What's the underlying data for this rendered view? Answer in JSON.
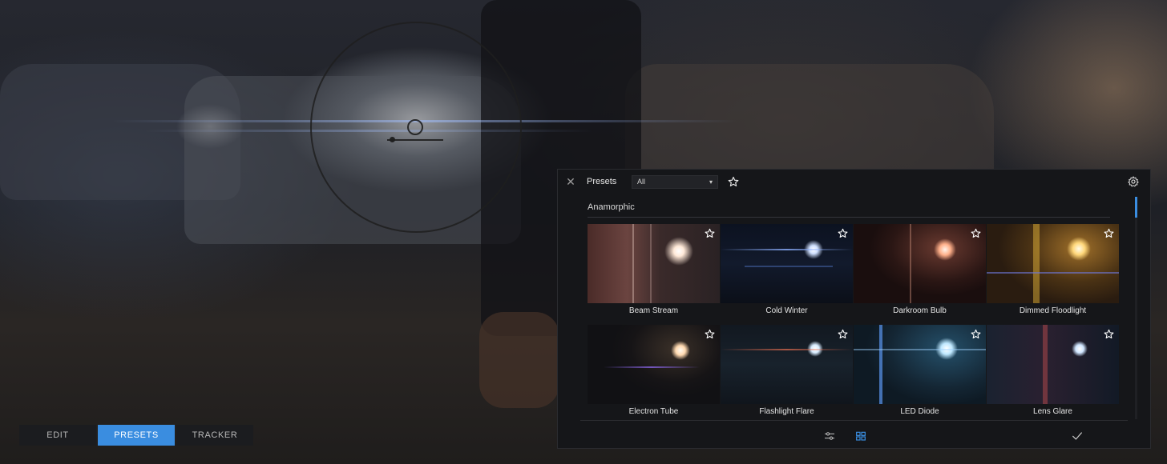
{
  "mode_tabs": [
    {
      "label": "EDIT",
      "active": false
    },
    {
      "label": "PRESETS",
      "active": true
    },
    {
      "label": "TRACKER",
      "active": false
    }
  ],
  "panel": {
    "title": "Presets",
    "filter": {
      "selected": "All"
    },
    "category": "Anamorphic",
    "presets": [
      {
        "label": "Beam Stream"
      },
      {
        "label": "Cold Winter"
      },
      {
        "label": "Darkroom Bulb"
      },
      {
        "label": "Dimmed Floodlight"
      },
      {
        "label": "Electron Tube"
      },
      {
        "label": "Flashlight Flare"
      },
      {
        "label": "LED Diode"
      },
      {
        "label": "Lens Glare"
      }
    ]
  },
  "colors": {
    "accent": "#3a8de0",
    "panel_bg": "#151619",
    "tab_bg": "#1b1c1f"
  },
  "icons": {
    "close": "close-icon",
    "favorite": "star-icon",
    "settings": "gear-icon",
    "confirm": "checkmark-icon",
    "adjust": "sliders-icon",
    "grid": "grid-icon"
  }
}
